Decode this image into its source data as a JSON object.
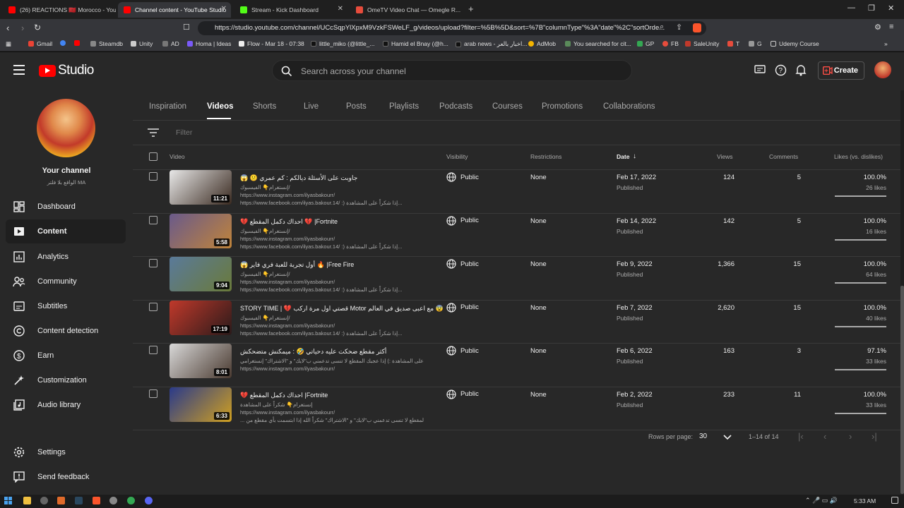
{
  "browser": {
    "tabs": [
      {
        "title": "(26) REACTIONS 🇲🇦 Morocco - YouTube",
        "favicon_color": "#ff0000"
      },
      {
        "title": "Channel content - YouTube Studio",
        "favicon_color": "#ff0000"
      },
      {
        "title": "Stream - Kick Dashboard",
        "favicon_color": "#53fc18"
      },
      {
        "title": "OmeTV Video Chat — Omegle R...",
        "favicon_color": "#e74c3c"
      }
    ],
    "url": "https://studio.youtube.com/channel/UCcSqpYlXpxM9VzkFSWeLF_g/videos/upload?filter=%5B%5D&sort=%7B\"columnType\"%3A\"date\"%2C\"sortOrde...",
    "bookmarks": [
      "Gmail",
      "Steamdb",
      "Unity",
      "AD",
      "Homa | Ideas",
      "Flow - Mar 18 - 07:38",
      "little_miko (@little_...",
      "Hamid el Bnay (@h...",
      "arab news - اخبار بالعر...",
      "AdMob",
      "You searched for cit...",
      "GP",
      "FB",
      "SaleUnity",
      "T",
      "G",
      "Udemy Course"
    ]
  },
  "header": {
    "logo_text": "Studio",
    "search_placeholder": "Search across your channel",
    "create_label": "Create"
  },
  "sidebar": {
    "channel_label": "Your channel",
    "channel_name": "الواقع بلا فلتر MA",
    "items": [
      {
        "label": "Dashboard",
        "icon": "dashboard-icon",
        "active": false
      },
      {
        "label": "Content",
        "icon": "content-icon",
        "active": true
      },
      {
        "label": "Analytics",
        "icon": "analytics-icon",
        "active": false
      },
      {
        "label": "Community",
        "icon": "community-icon",
        "active": false
      },
      {
        "label": "Subtitles",
        "icon": "subtitles-icon",
        "active": false
      },
      {
        "label": "Content detection",
        "icon": "copyright-icon",
        "active": false
      },
      {
        "label": "Earn",
        "icon": "dollar-icon",
        "active": false
      },
      {
        "label": "Customization",
        "icon": "customization-icon",
        "active": false
      },
      {
        "label": "Audio library",
        "icon": "audio-library-icon",
        "active": false
      }
    ],
    "bottom_items": [
      {
        "label": "Settings",
        "icon": "gear-icon"
      },
      {
        "label": "Send feedback",
        "icon": "feedback-icon"
      }
    ]
  },
  "content_tabs": [
    "Inspiration",
    "Videos",
    "Shorts",
    "Live",
    "Posts",
    "Playlists",
    "Podcasts",
    "Courses",
    "Promotions",
    "Collaborations"
  ],
  "filter_placeholder": "Filter",
  "columns": {
    "video": "Video",
    "visibility": "Visibility",
    "restrictions": "Restrictions",
    "date": "Date",
    "views": "Views",
    "comments": "Comments",
    "likes": "Likes (vs. dislikes)"
  },
  "videos": [
    {
      "title": "😱 😕 جاوبت على الأسئلة ديالكم : كم عمري",
      "desc1": "إنستغرام👇 الفيسبوك/",
      "desc2": "https://www.instagram.com/ilyasbakourr/",
      "desc3": "https://www.facebook.com/ilyas.bakour.14/ :) إذا شكراً على المشاهدة...",
      "duration": "11:21",
      "visibility": "Public",
      "restrictions": "None",
      "date": "Feb 17, 2022",
      "status": "Published",
      "views": "124",
      "comments": "5",
      "likes_pct": "100.0%",
      "likes_count": "26 likes",
      "thumb_colors": [
        "#e8e8e8",
        "#3a2a20"
      ]
    },
    {
      "title": "💔 احداك دكمل المقطع 💔 |Fortnite",
      "desc1": "إنستغرام👇 الفيسبوك/",
      "desc2": "https://www.instagram.com/ilyasbakourr/",
      "desc3": "https://www.facebook.com/ilyas.bakour.14/ :) إذا شكراً على المشاهدة...",
      "duration": "5:58",
      "visibility": "Public",
      "restrictions": "None",
      "date": "Feb 14, 2022",
      "status": "Published",
      "views": "142",
      "comments": "5",
      "likes_pct": "100.0%",
      "likes_count": "16 likes",
      "thumb_colors": [
        "#6a5a8a",
        "#c0843a"
      ]
    },
    {
      "title": "😱 أول تجربة للعبة فري فاير 🔥 |Free Fire",
      "desc1": "إنستغرام👇 الفيسبوك/",
      "desc2": "https://www.instagram.com/ilyasbakourr/",
      "desc3": "https://www.facebook.com/ilyas.bakour.14/ :) إذا شكراً على المشاهدة...",
      "duration": "9:04",
      "visibility": "Public",
      "restrictions": "None",
      "date": "Feb 9, 2022",
      "status": "Published",
      "views": "1,366",
      "comments": "15",
      "likes_pct": "100.0%",
      "likes_count": "64 likes",
      "thumb_colors": [
        "#5a7a9a",
        "#6a7a3a"
      ]
    },
    {
      "title": "STORY TIME | 💔 قصتي اول مرة اركب Motor مع اعبى صديق في العالم 😨",
      "desc1": "إنستغرام👇 الفيسبوك/",
      "desc2": "https://www.instagram.com/ilyasbakourr/",
      "desc3": "https://www.facebook.com/ilyas.bakour.14/ :) إذا شكراً على المشاهدة...",
      "duration": "17:19",
      "visibility": "Public",
      "restrictions": "None",
      "date": "Feb 7, 2022",
      "status": "Published",
      "views": "2,620",
      "comments": "15",
      "likes_pct": "100.0%",
      "likes_count": "40 likes",
      "thumb_colors": [
        "#c0392b",
        "#2a1a1a"
      ]
    },
    {
      "title": "أكثر مقطع ضحكت عليه دحياتي 🤣 : ميمكنش متضحكش",
      "desc1": "شكراً على المشاهدة :) إذا عجبك المقطع لا تنسى تدعمني ب\"لايك\" و \"الاشتراك\" إنستغرامي👇",
      "desc2": "https://www.instagram.com/ilyasbakourr/",
      "desc3": "",
      "duration": "8:01",
      "visibility": "Public",
      "restrictions": "None",
      "date": "Feb 6, 2022",
      "status": "Published",
      "views": "163",
      "comments": "3",
      "likes_pct": "97.1%",
      "likes_count": "33 likes",
      "thumb_colors": [
        "#d8d8d8",
        "#4a3a30"
      ]
    },
    {
      "title": "💔 احداك دكمل المقطع |Fortnite",
      "desc1": "إنستغرام👇 شكراً على المشاهدة",
      "desc2": "https://www.instagram.com/ilyasbakourr/",
      "desc3": "... إذا عجبك المقطع لا تنسى تدعمني ب\"لايك\" و \"الاشتراك\" شكراً الله إذا ابتسمت بأي مقطع من",
      "duration": "6:33",
      "visibility": "Public",
      "restrictions": "None",
      "date": "Feb 2, 2022",
      "status": "Published",
      "views": "233",
      "comments": "11",
      "likes_pct": "100.0%",
      "likes_count": "33 likes",
      "thumb_colors": [
        "#2a3a8a",
        "#d0a020"
      ]
    }
  ],
  "pagination": {
    "rows_per_page_label": "Rows per page:",
    "rows_per_page": "30",
    "range": "1–14 of 14"
  },
  "taskbar": {
    "clock": "5:33 AM"
  }
}
